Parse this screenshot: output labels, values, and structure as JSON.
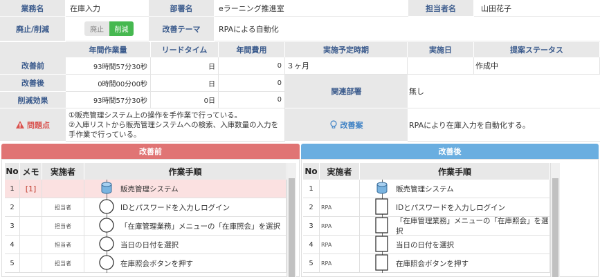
{
  "info": {
    "task_label": "業務名",
    "task_value": "在庫入力",
    "dept_label": "部署名",
    "dept_value": "eラーニング推進室",
    "owner_label": "担当者名",
    "owner_value": "山田花子",
    "abolish_label": "廃止/削減",
    "toggle_abolish": "廃止",
    "toggle_reduce": "削減",
    "theme_label": "改善テーマ",
    "theme_value": "RPAによる自動化"
  },
  "metrics": {
    "headers": [
      "年間作業量",
      "リードタイム",
      "年間費用",
      "実施予定時期",
      "実施日",
      "提案ステータス"
    ],
    "before_label": "改善前",
    "after_label": "改善後",
    "effect_label": "削減効果",
    "before": {
      "work": "93時間57分30秒",
      "lead": "日",
      "cost": "0",
      "schedule": "３ヶ月",
      "date": "",
      "status": "作成中"
    },
    "after": {
      "work": "0時間00分00秒",
      "lead": "日",
      "cost": "0"
    },
    "effect": {
      "work": "93時間57分30秒",
      "lead": "0日",
      "cost": "0"
    },
    "related_label": "関連部署",
    "related_value": "無し"
  },
  "problem": {
    "label": "問題点",
    "text": "①販売管理システム上の操作を手作業で行っている。\n②入庫リストから販売管理システムへの検索、入庫数量の入力を手作業で行っている。",
    "plan_label": "改善案",
    "plan_text": "RPAにより在庫入力を自動化する。"
  },
  "before_panel": {
    "title": "改善前",
    "columns": [
      "No",
      "メモ",
      "実施者",
      "作業手順"
    ],
    "rows": [
      {
        "no": "1",
        "memo": "[1]",
        "actor": "",
        "step": "販売管理システム"
      },
      {
        "no": "2",
        "memo": "",
        "actor": "担当者",
        "step": "IDとパスワードを入力しログイン"
      },
      {
        "no": "3",
        "memo": "",
        "actor": "担当者",
        "step": "「在庫管理業務」メニューの「在庫照会」を選択"
      },
      {
        "no": "4",
        "memo": "",
        "actor": "担当者",
        "step": "当日の日付を選択"
      },
      {
        "no": "5",
        "memo": "",
        "actor": "担当者",
        "step": "在庫照会ボタンを押す"
      }
    ]
  },
  "after_panel": {
    "title": "改善後",
    "columns": [
      "No",
      "実施者",
      "作業手順"
    ],
    "rows": [
      {
        "no": "1",
        "actor": "",
        "step": "販売管理システム"
      },
      {
        "no": "2",
        "actor": "RPA",
        "step": "IDとパスワードを入力しログイン"
      },
      {
        "no": "3",
        "actor": "RPA",
        "step": "「在庫管理業務」メニューの「在庫照会」を選択"
      },
      {
        "no": "4",
        "actor": "RPA",
        "step": "当日の日付を選択"
      },
      {
        "no": "5",
        "actor": "RPA",
        "step": "在庫照会ボタンを押す"
      }
    ]
  },
  "colors": {
    "before_head": "#e07474",
    "after_head": "#6aaee0",
    "selected_row": "#fbe1e1",
    "toggle_on": "#46b850",
    "problem_red": "#d9534f",
    "plan_blue": "#3a7fc4"
  }
}
